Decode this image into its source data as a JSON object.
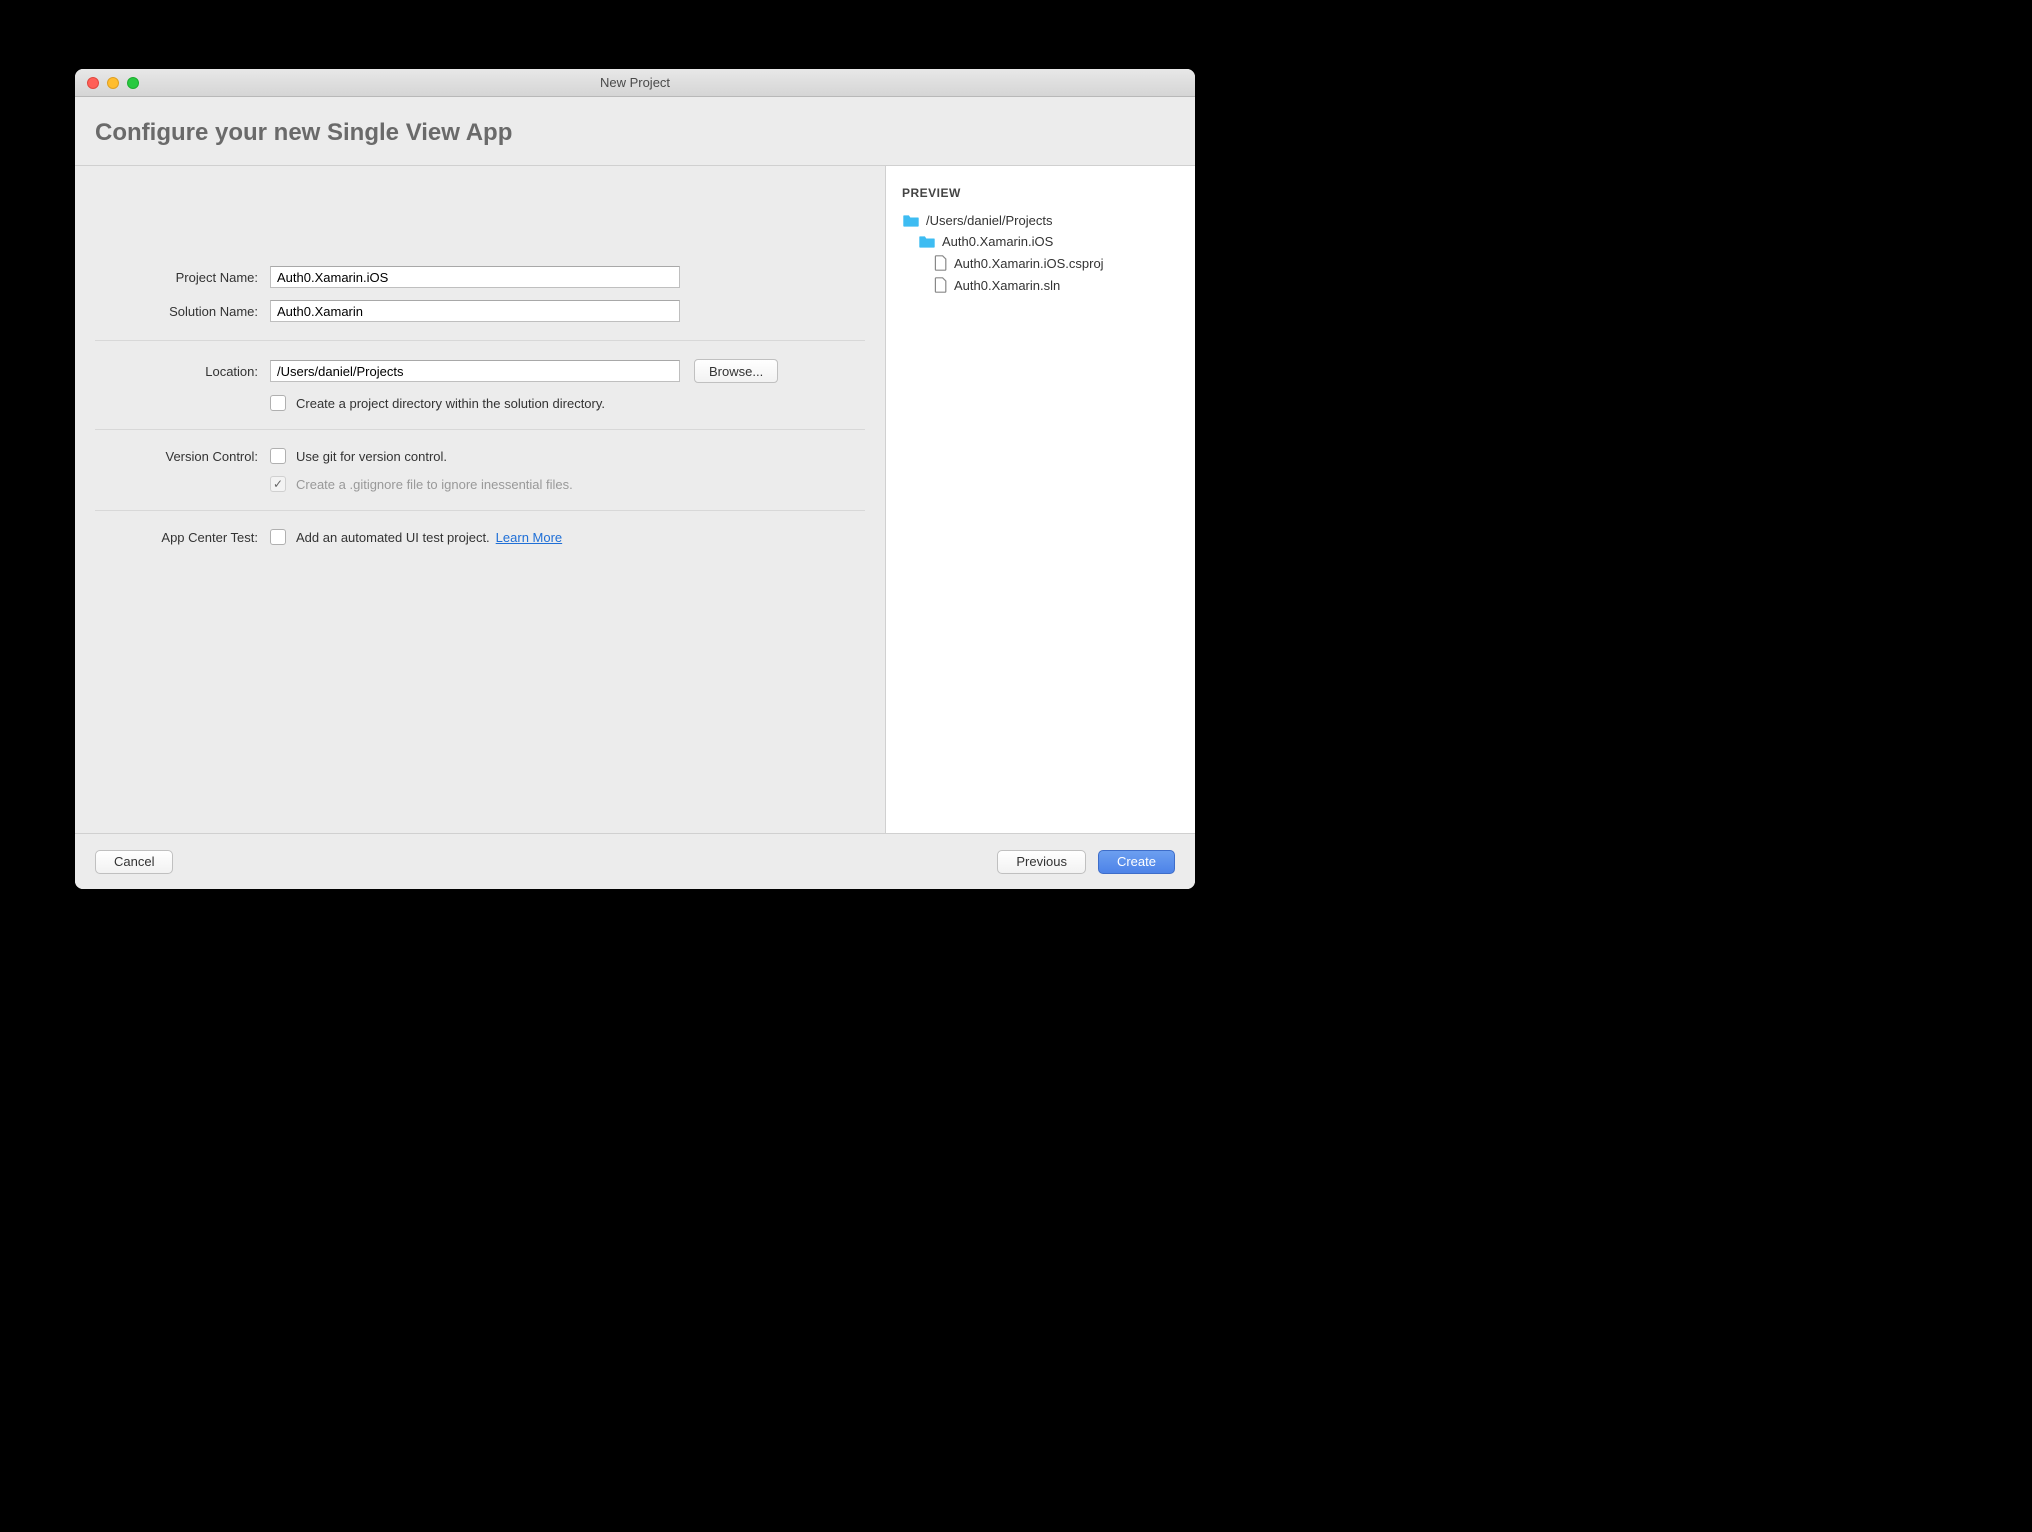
{
  "window": {
    "title": "New Project"
  },
  "header": {
    "title": "Configure your new Single View App"
  },
  "form": {
    "project_name_label": "Project Name:",
    "project_name_value": "Auth0.Xamarin.iOS",
    "solution_name_label": "Solution Name:",
    "solution_name_value": "Auth0.Xamarin",
    "location_label": "Location:",
    "location_value": "/Users/daniel/Projects",
    "browse_label": "Browse...",
    "create_dir_label": "Create a project directory within the solution directory.",
    "version_control_label": "Version Control:",
    "use_git_label": "Use git for version control.",
    "gitignore_label": "Create a .gitignore file to ignore inessential files.",
    "appcenter_label": "App Center Test:",
    "uitest_label": "Add an automated UI test project.",
    "learn_more_label": "Learn More"
  },
  "preview": {
    "title": "PREVIEW",
    "items": [
      {
        "type": "folder",
        "name": "/Users/daniel/Projects",
        "indent": 0
      },
      {
        "type": "folder",
        "name": "Auth0.Xamarin.iOS",
        "indent": 1
      },
      {
        "type": "file",
        "name": "Auth0.Xamarin.iOS.csproj",
        "indent": 2
      },
      {
        "type": "file",
        "name": "Auth0.Xamarin.sln",
        "indent": 2
      }
    ]
  },
  "footer": {
    "cancel_label": "Cancel",
    "previous_label": "Previous",
    "create_label": "Create"
  }
}
